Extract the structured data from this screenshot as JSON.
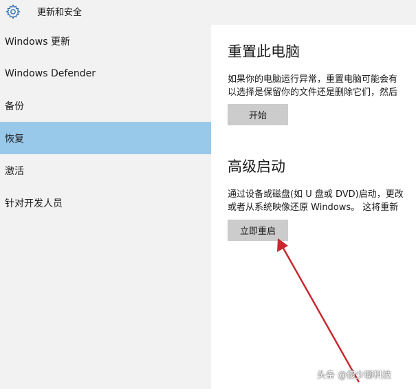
{
  "window": {
    "title": "更新和安全",
    "icon": "gear-icon"
  },
  "sidebar": {
    "items": [
      {
        "label": "Windows 更新",
        "selected": false
      },
      {
        "label": "Windows Defender",
        "selected": false
      },
      {
        "label": "备份",
        "selected": false
      },
      {
        "label": "恢复",
        "selected": true
      },
      {
        "label": "激活",
        "selected": false
      },
      {
        "label": "针对开发人员",
        "selected": false
      }
    ]
  },
  "reset": {
    "title": "重置此电脑",
    "desc_line1": "如果你的电脑运行异常，重置电脑可能会有",
    "desc_line2": "以选择是保留你的文件还是删除它们，然后",
    "button_label": "开始"
  },
  "advanced": {
    "title": "高级启动",
    "desc_line1": "通过设备或磁盘(如 U 盘或 DVD)启动，更改",
    "desc_line2": "或者从系统映像还原 Windows。 这将重新",
    "button_label": "立即重启"
  },
  "annotation": {
    "arrow_color": "#c8282d"
  },
  "watermark": {
    "text": "头条 @傻少聊科技"
  },
  "colors": {
    "sidebar_bg": "#f2f2f2",
    "selected_bg": "#99c9ea",
    "button_bg": "#cccccc",
    "accent": "#2b6cb0"
  }
}
